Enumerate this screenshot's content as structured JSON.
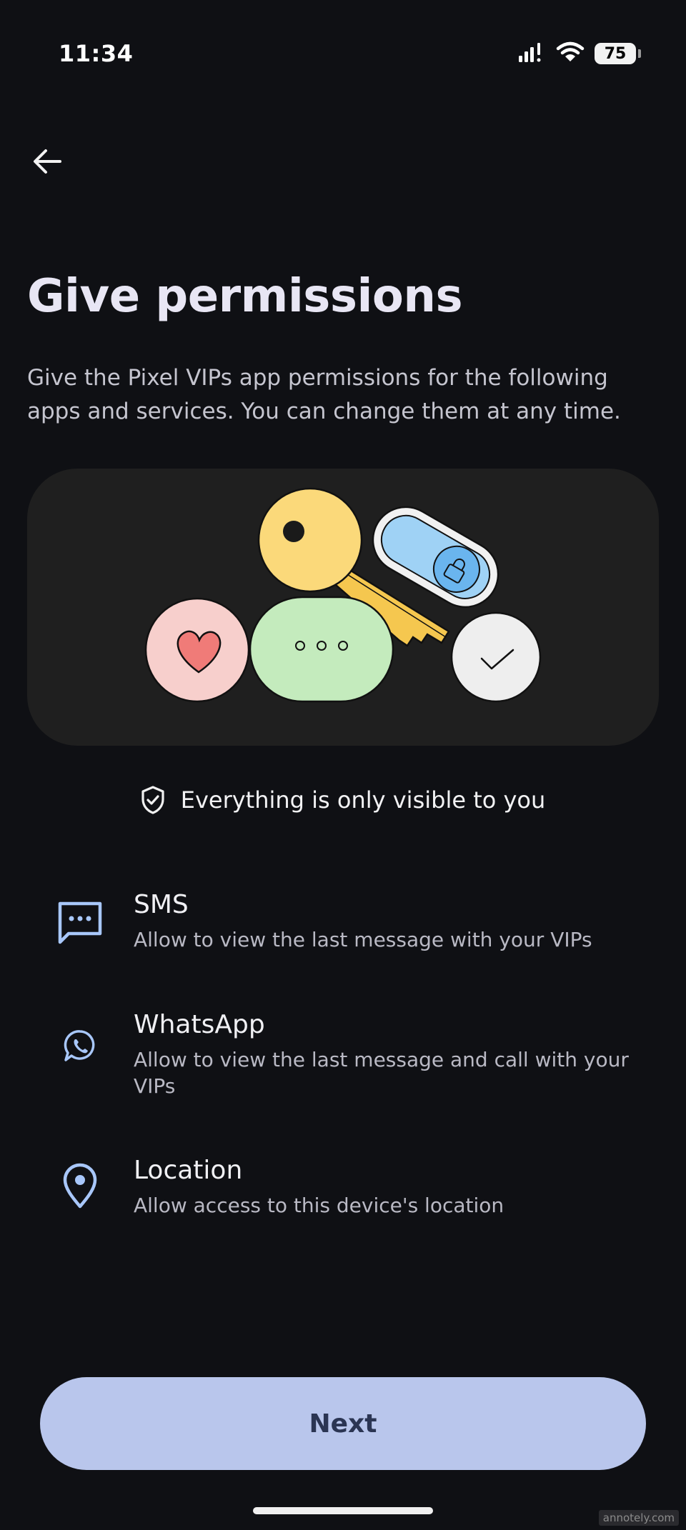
{
  "status_bar": {
    "time": "11:34",
    "battery_level": "75",
    "icons": [
      "signal-icon",
      "wifi-icon",
      "battery-icon"
    ]
  },
  "header": {
    "back_icon": "arrow-left-icon",
    "title": "Give permissions",
    "subtitle": "Give the Pixel VIPs app permissions for the following apps and services. You can change them at any time."
  },
  "illustration": {
    "elements": [
      "key",
      "lock-tag",
      "heart-bubble",
      "message-bubble",
      "check-bubble"
    ]
  },
  "privacy_note": {
    "icon": "shield-check-icon",
    "text": "Everything is only visible to you"
  },
  "permissions": [
    {
      "icon": "sms-icon",
      "title": "SMS",
      "description": "Allow to view the last message with your VIPs"
    },
    {
      "icon": "whatsapp-icon",
      "title": "WhatsApp",
      "description": "Allow to view the last message and call with your VIPs"
    },
    {
      "icon": "location-pin-icon",
      "title": "Location",
      "description": "Allow access to this device's location"
    }
  ],
  "actions": {
    "next_label": "Next"
  },
  "watermark": "annotely.com",
  "colors": {
    "background": "#0f1014",
    "card": "#1f1f1f",
    "icon_tint": "#a8c7fa",
    "button": "#b9c6ec",
    "button_text": "#2b3553"
  }
}
